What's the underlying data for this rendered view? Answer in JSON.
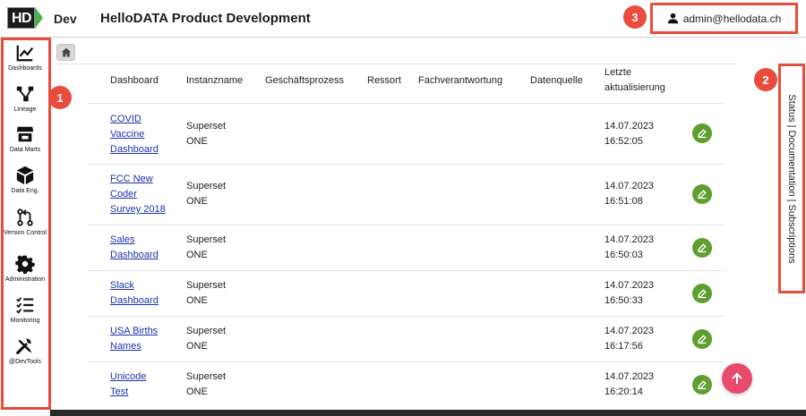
{
  "header": {
    "logo_text": "HD",
    "env": "Dev",
    "title": "HelloDATA Product Development",
    "user": "admin@hellodata.ch"
  },
  "sidebar": {
    "items": [
      {
        "label": "Dashboards",
        "icon": "chart-line-icon"
      },
      {
        "label": "Lineage",
        "icon": "lineage-icon"
      },
      {
        "label": "Data Marts",
        "icon": "store-icon"
      },
      {
        "label": "Data Eng.",
        "icon": "cube-icon"
      },
      {
        "label": "Version Control",
        "icon": "git-pull-request-icon"
      },
      {
        "label": "Administration",
        "icon": "gear-icon"
      },
      {
        "label": "Monitoring",
        "icon": "checklist-icon"
      },
      {
        "label": "@DevTools",
        "icon": "tools-icon"
      }
    ]
  },
  "table": {
    "headers": [
      "Dashboard",
      "Instanzname",
      "Geschäftsprozess",
      "Ressort",
      "Fachverantwortung",
      "Datenquelle",
      "Letzte",
      "aktualisierung"
    ],
    "rows": [
      {
        "name": [
          "COVID",
          "Vaccine",
          "Dashboard"
        ],
        "instance": [
          "Superset",
          "ONE"
        ],
        "date": "14.07.2023",
        "time": "16:52:05"
      },
      {
        "name": [
          "FCC New",
          "Coder",
          "Survey 2018"
        ],
        "instance": [
          "Superset",
          "ONE"
        ],
        "date": "14.07.2023",
        "time": "16:51:08"
      },
      {
        "name": [
          "Sales",
          "Dashboard"
        ],
        "instance": [
          "Superset",
          "ONE"
        ],
        "date": "14.07.2023",
        "time": "16:50:03"
      },
      {
        "name": [
          "Slack",
          "Dashboard"
        ],
        "instance": [
          "Superset",
          "ONE"
        ],
        "date": "14.07.2023",
        "time": "16:50:33"
      },
      {
        "name": [
          "USA Births",
          "Names"
        ],
        "instance": [
          "Superset",
          "ONE"
        ],
        "date": "14.07.2023",
        "time": "16:17:56"
      },
      {
        "name": [
          "Unicode",
          "Test"
        ],
        "instance": [
          "Superset",
          "ONE"
        ],
        "date": "14.07.2023",
        "time": "16:20:14"
      }
    ]
  },
  "right_tab": {
    "label": "Status | Documentation | Subscriptions"
  },
  "markers": [
    "1",
    "2",
    "3"
  ],
  "colors": {
    "accent": "#e94b3c",
    "edit": "#5e9f2f",
    "scroll": "#e84a6c",
    "link": "#1a33a8"
  }
}
